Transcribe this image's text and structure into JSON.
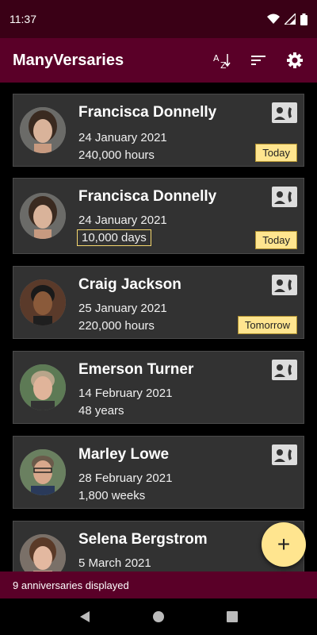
{
  "status": {
    "time": "11:37"
  },
  "appbar": {
    "title": "ManyVersaries",
    "sort_alpha_icon": "sort-alphabetical-icon",
    "sort_icon": "sort-icon",
    "settings_icon": "gear-icon"
  },
  "cards": [
    {
      "name": "Francisca Donnelly",
      "date": "24 January 2021",
      "duration": "240,000 hours",
      "badge": "Today"
    },
    {
      "name": "Francisca Donnelly",
      "date": "24 January 2021",
      "duration": "10,000 days",
      "badge": "Today"
    },
    {
      "name": "Craig Jackson",
      "date": "25 January 2021",
      "duration": "220,000 hours",
      "badge": "Tomorrow"
    },
    {
      "name": "Emerson Turner",
      "date": "14 February 2021",
      "duration": "48 years"
    },
    {
      "name": "Marley Lowe",
      "date": "28 February 2021",
      "duration": "1,800 weeks"
    },
    {
      "name": "Selena Bergstrom",
      "date": "5 March 2021"
    }
  ],
  "fab": {
    "label": "+"
  },
  "footer": {
    "text": "9 anniversaries displayed"
  },
  "colors": {
    "status_bar": "#3a0016",
    "app_bar": "#5a0028",
    "badge": "#ffe58f",
    "card": "#323232"
  }
}
